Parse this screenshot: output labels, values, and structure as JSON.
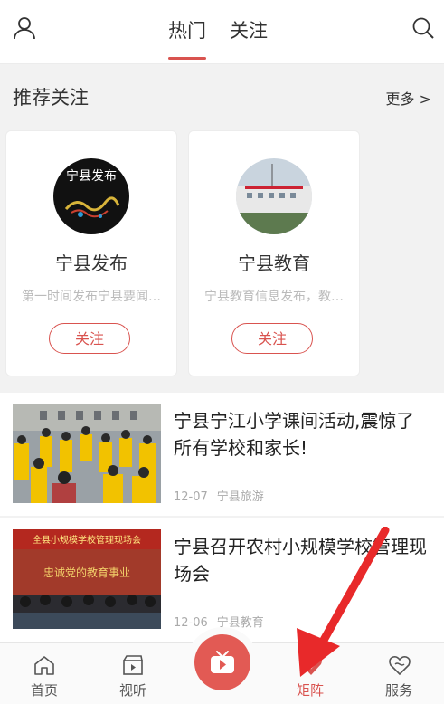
{
  "header": {
    "tabs": [
      {
        "label": "热门"
      },
      {
        "label": "关注"
      }
    ]
  },
  "recommend": {
    "title": "推荐关注",
    "more": "更多 >",
    "cards": [
      {
        "name": "宁县发布",
        "desc": "第一时间发布宁县要闻…",
        "follow": "关注"
      },
      {
        "name": "宁县教育",
        "desc": "宁县教育信息发布，教…",
        "follow": "关注"
      }
    ]
  },
  "news": [
    {
      "title": "宁县宁江小学课间活动,震惊了所有学校和家长!",
      "date": "12-07",
      "source": "宁县旅游"
    },
    {
      "title": "宁县召开农村小规模学校管理现场会",
      "date": "12-06",
      "source": "宁县教育",
      "banner": "全县小规模学校管理现场会",
      "slogan": "忠诚党的教育事业"
    }
  ],
  "card_logo_text": "宁县发布",
  "nav": [
    {
      "label": "首页",
      "icon": "home-icon"
    },
    {
      "label": "视听",
      "icon": "video-clapper-icon"
    },
    {
      "label": "",
      "icon": "tv-play-icon"
    },
    {
      "label": "矩阵",
      "icon": "matrix-heart-icon"
    },
    {
      "label": "服务",
      "icon": "service-heart-icon"
    }
  ],
  "colors": {
    "accent": "#d9534f",
    "center_button": "#e25a54",
    "arrow": "#e8292a"
  }
}
